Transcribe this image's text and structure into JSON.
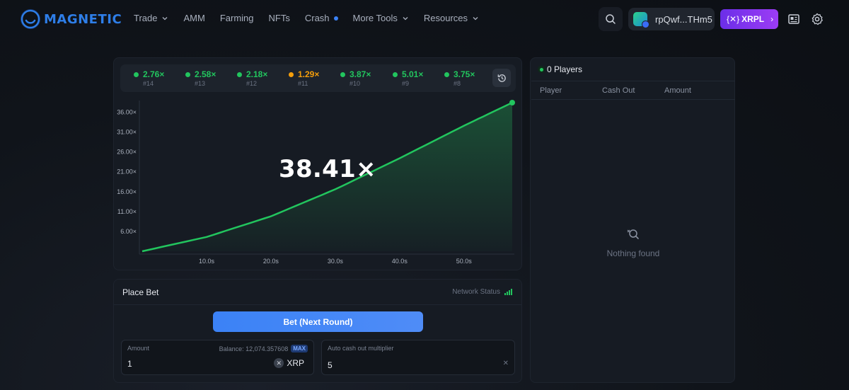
{
  "nav": {
    "logo_text": "MAGNETIC",
    "menu": [
      {
        "label": "Trade",
        "dropdown": true
      },
      {
        "label": "AMM",
        "dropdown": false
      },
      {
        "label": "Farming",
        "dropdown": false
      },
      {
        "label": "NFTs",
        "dropdown": false
      },
      {
        "label": "Crash",
        "dropdown": false,
        "badge_dot": true
      },
      {
        "label": "More Tools",
        "dropdown": true
      },
      {
        "label": "Resources",
        "dropdown": true
      }
    ],
    "wallet_address": "rpQwf...THm5",
    "network_button": "XRPL",
    "icons": [
      "search-icon",
      "news-icon",
      "settings-icon"
    ]
  },
  "history": [
    {
      "mult": "2.76×",
      "round": "#14",
      "color": "#22c55e"
    },
    {
      "mult": "2.58×",
      "round": "#13",
      "color": "#22c55e"
    },
    {
      "mult": "2.18×",
      "round": "#12",
      "color": "#22c55e"
    },
    {
      "mult": "1.29×",
      "round": "#11",
      "color": "#f59e0b"
    },
    {
      "mult": "3.87×",
      "round": "#10",
      "color": "#22c55e"
    },
    {
      "mult": "5.01×",
      "round": "#9",
      "color": "#22c55e"
    },
    {
      "mult": "3.75×",
      "round": "#8",
      "color": "#22c55e"
    }
  ],
  "current_multiplier": "38.41×",
  "chart_data": {
    "type": "area",
    "y_ticks": [
      "6.00×",
      "11.00×",
      "16.00×",
      "21.00×",
      "26.00×",
      "31.00×",
      "36.00×"
    ],
    "x_ticks": [
      "10.0s",
      "20.0s",
      "30.0s",
      "40.0s",
      "50.0s"
    ],
    "ylim": [
      1,
      38.41
    ],
    "xlim": [
      0,
      57.5
    ],
    "series": [
      {
        "x": [
          0,
          10,
          20,
          30,
          40,
          50,
          57.5
        ],
        "y": [
          1.0,
          4.6,
          9.8,
          16.6,
          24.4,
          32.6,
          38.41
        ]
      }
    ],
    "line_color": "#22c55e"
  },
  "players": {
    "count_label": "0 Players",
    "columns": [
      "Player",
      "Cash Out",
      "Amount"
    ],
    "empty_text": "Nothing found"
  },
  "bet": {
    "title": "Place Bet",
    "network_status": "Network Status",
    "button": "Bet (Next Round)",
    "amount_label": "Amount",
    "balance": "Balance: 12,074.357608",
    "max_label": "MAX",
    "amount_value": "1",
    "currency": "XRP",
    "auto_label": "Auto cash out multiplier",
    "auto_value": "5"
  }
}
